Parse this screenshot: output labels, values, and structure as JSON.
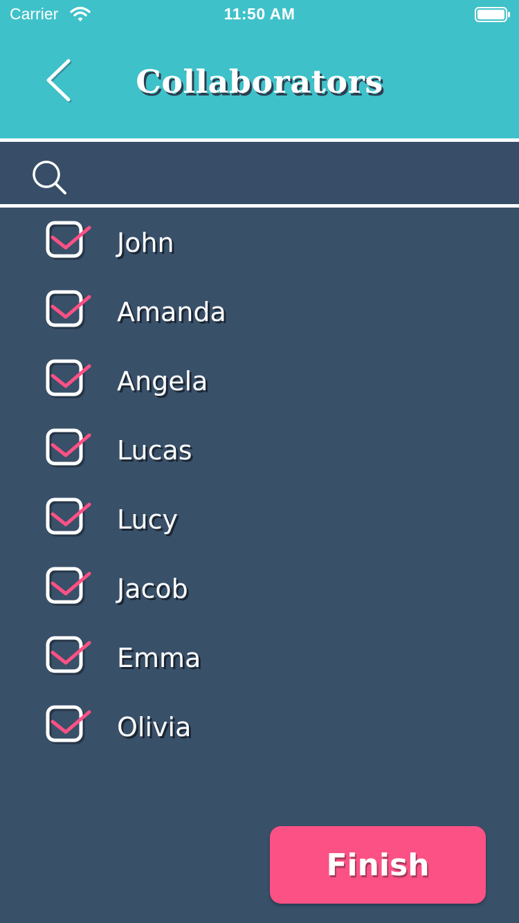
{
  "status_bar": {
    "carrier": "Carrier",
    "time": "11:50 AM",
    "wifi_icon": "wifi-icon",
    "battery_icon": "battery-icon"
  },
  "header": {
    "title": "Collaborators",
    "back_icon": "chevron-left-icon"
  },
  "search": {
    "icon": "search-icon",
    "placeholder": "",
    "value": ""
  },
  "collaborators": [
    {
      "name": "John",
      "checked": true
    },
    {
      "name": "Amanda",
      "checked": true
    },
    {
      "name": "Angela",
      "checked": true
    },
    {
      "name": "Lucas",
      "checked": true
    },
    {
      "name": "Lucy",
      "checked": true
    },
    {
      "name": "Jacob",
      "checked": true
    },
    {
      "name": "Emma",
      "checked": true
    },
    {
      "name": "Olivia",
      "checked": true
    }
  ],
  "footer": {
    "finish_label": "Finish"
  },
  "colors": {
    "header_bg": "#3fc1c9",
    "body_bg": "#395069",
    "accent": "#fc5185",
    "text": "#ffffff"
  }
}
